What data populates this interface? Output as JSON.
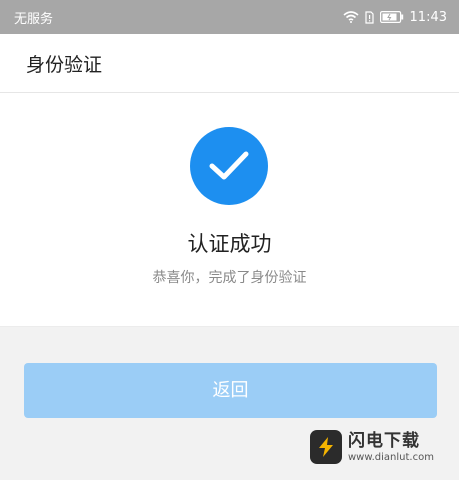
{
  "status_bar": {
    "carrier": "无服务",
    "time": "11:43"
  },
  "header": {
    "title": "身份验证"
  },
  "result": {
    "title": "认证成功",
    "subtitle": "恭喜你，完成了身份验证"
  },
  "actions": {
    "back_label": "返回"
  },
  "watermark": {
    "title": "闪电下载",
    "url": "www.dianlut.com"
  },
  "colors": {
    "accent": "#1d8ff0",
    "button_disabled": "#9bcdf6",
    "status_bar": "#a7a7a7"
  }
}
